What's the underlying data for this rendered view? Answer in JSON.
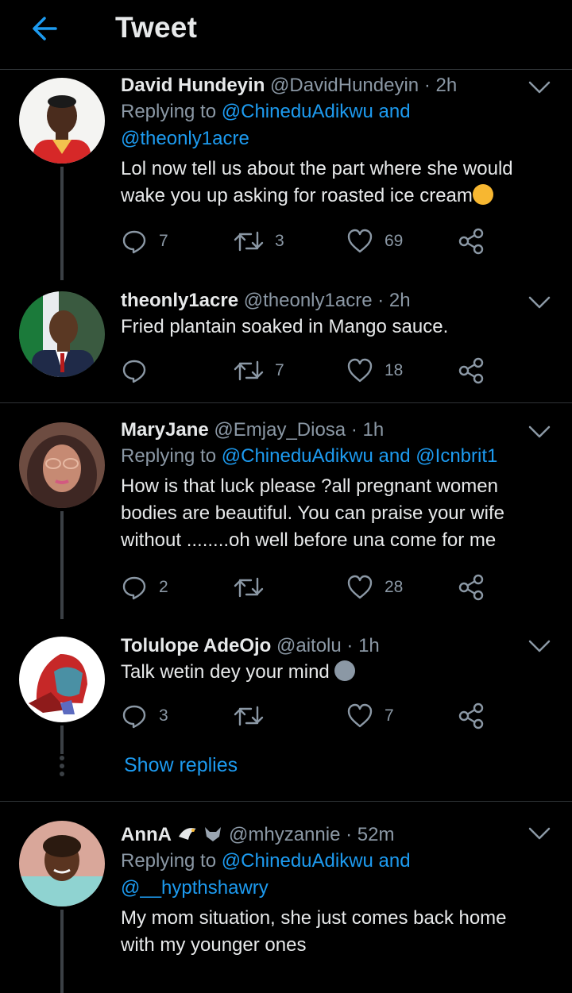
{
  "header": {
    "title": "Tweet"
  },
  "tweets": [
    {
      "name": "David Hundeyin",
      "handle": "@DavidHundeyin",
      "time": "2h",
      "reply_prefix": "Replying to ",
      "reply_user1": "@ChineduAdikwu",
      "reply_and": " and",
      "reply_user2": "@theonly1acre",
      "text1": "Lol now tell us about the part where she would",
      "text2": "wake you up asking for roasted ice cream",
      "replies": "7",
      "retweets": "3",
      "likes": "69"
    },
    {
      "name": "theonly1acre",
      "handle": "@theonly1acre",
      "time": "2h",
      "text1": "Fried plantain soaked in Mango sauce.",
      "replies": "",
      "retweets": "7",
      "likes": "18"
    },
    {
      "name": "MaryJane",
      "handle": "@Emjay_Diosa",
      "time": "1h",
      "reply_prefix": "Replying to ",
      "reply_user1": "@ChineduAdikwu",
      "reply_and": " and ",
      "reply_user2": "@Icnbrit1",
      "text1": "How is that luck please ?all pregnant women",
      "text2": "bodies are beautiful. You can praise your wife",
      "text3": "without ........oh well before una come for me",
      "replies": "2",
      "retweets": "",
      "likes": "28"
    },
    {
      "name": "Tolulope AdeOjo",
      "handle": "@aitolu",
      "time": "1h",
      "text1": "Talk wetin dey your mind",
      "replies": "3",
      "retweets": "",
      "likes": "7"
    },
    {
      "name": "AnnA",
      "handle": "@mhyzannie",
      "time": "52m",
      "reply_prefix": "Replying to ",
      "reply_user1": "@ChineduAdikwu",
      "reply_and": " and",
      "reply_user2": "@__hypthshawry",
      "text1": "My mom situation, she just comes back home",
      "text2": "with my younger ones"
    }
  ],
  "show_replies": "Show replies",
  "dot_separator": " · ",
  "colors": {
    "accent": "#1d9bf0",
    "muted": "#8b98a5",
    "background": "#000000"
  }
}
